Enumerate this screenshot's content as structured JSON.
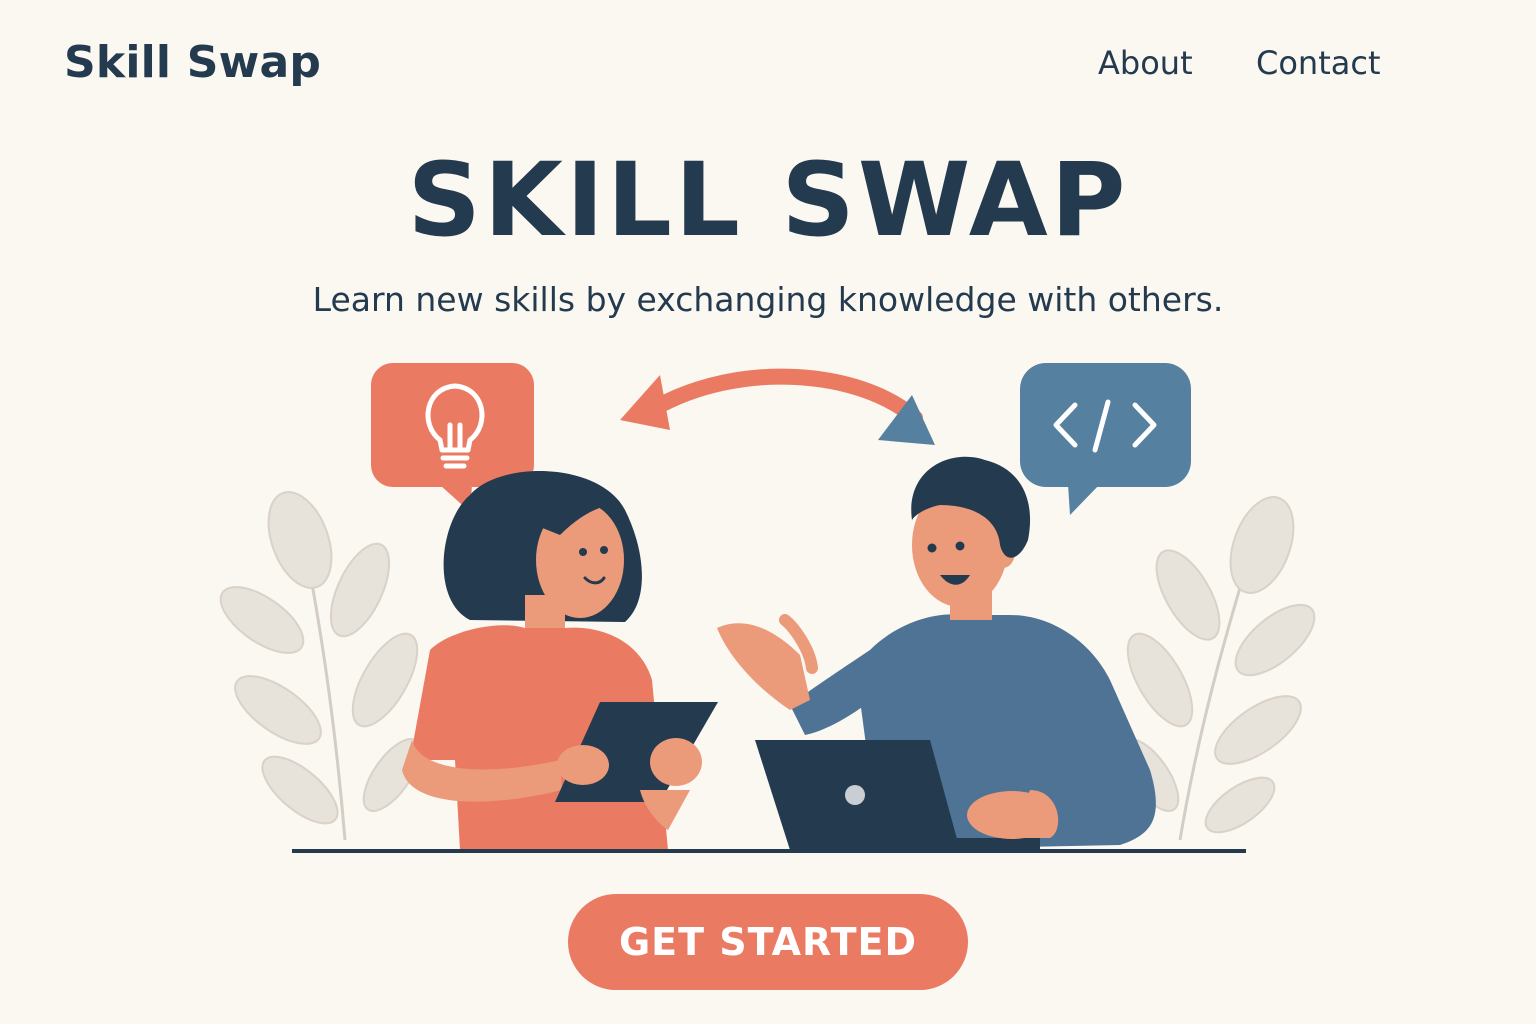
{
  "nav": {
    "brand": "Skill Swap",
    "links": [
      {
        "label": "About"
      },
      {
        "label": "Contact"
      }
    ]
  },
  "hero": {
    "title": "SKILL SWAP",
    "subtitle": "Learn new skills by exchanging knowledge with others."
  },
  "illustration": {
    "left_bubble_icon": "lightbulb-icon",
    "right_bubble_icon": "code-icon",
    "exchange_icon": "swap-arrow-icon"
  },
  "cta": {
    "label": "GET STARTED"
  },
  "colors": {
    "background": "#FBF7F1",
    "text": "#233A4F",
    "accent_coral": "#EB7A63",
    "accent_blue": "#56809F",
    "leaf": "#E7E2DA"
  }
}
